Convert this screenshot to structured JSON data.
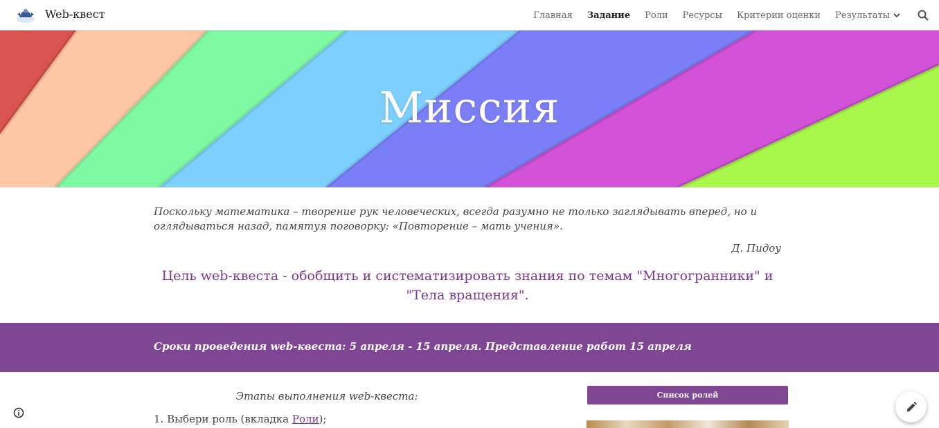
{
  "site": {
    "title": "Web-квест",
    "logo_icon": "site-logo-icon"
  },
  "nav": {
    "items": [
      {
        "label": "Главная",
        "active": false
      },
      {
        "label": "Задание",
        "active": true
      },
      {
        "label": "Роли",
        "active": false
      },
      {
        "label": "Ресурсы",
        "active": false
      },
      {
        "label": "Критерии оценки",
        "active": false
      },
      {
        "label": "Результаты",
        "active": false,
        "dropdown": true
      }
    ],
    "search_icon": "search-icon"
  },
  "banner": {
    "title": "Миссия",
    "stripe_colors": [
      "#d9534f",
      "#fdc7a5",
      "#7ff8a3",
      "#7dcffd",
      "#7b7ff7",
      "#d151d7",
      "#a8f84c"
    ]
  },
  "quote": {
    "text": "Поскольку математика – творение рук человеческих, всегда разумно не только заглядывать вперед, но и оглядываться назад, памятуя поговорку: «Повторение – мать учения».",
    "author": "Д. Пидоу"
  },
  "goal": {
    "line1": "Цель web-квеста - обобщить и систематизировать знания по темам \"Многогранники\" и",
    "line2": "\"Тела вращения\"."
  },
  "strip": {
    "text": "Сроки проведения web-квеста: 5 апреля - 15 апреля. Представление работ 15 апреля",
    "color": "#7f4693"
  },
  "stages": {
    "title": "Этапы  выполнения web-квеста:",
    "step1_prefix": "1. Выбери роль (вкладка ",
    "step1_link": "Роли",
    "step1_suffix": ");"
  },
  "sidebar": {
    "roles_button": "Список ролей"
  },
  "accent_color": "#7b3a8f"
}
